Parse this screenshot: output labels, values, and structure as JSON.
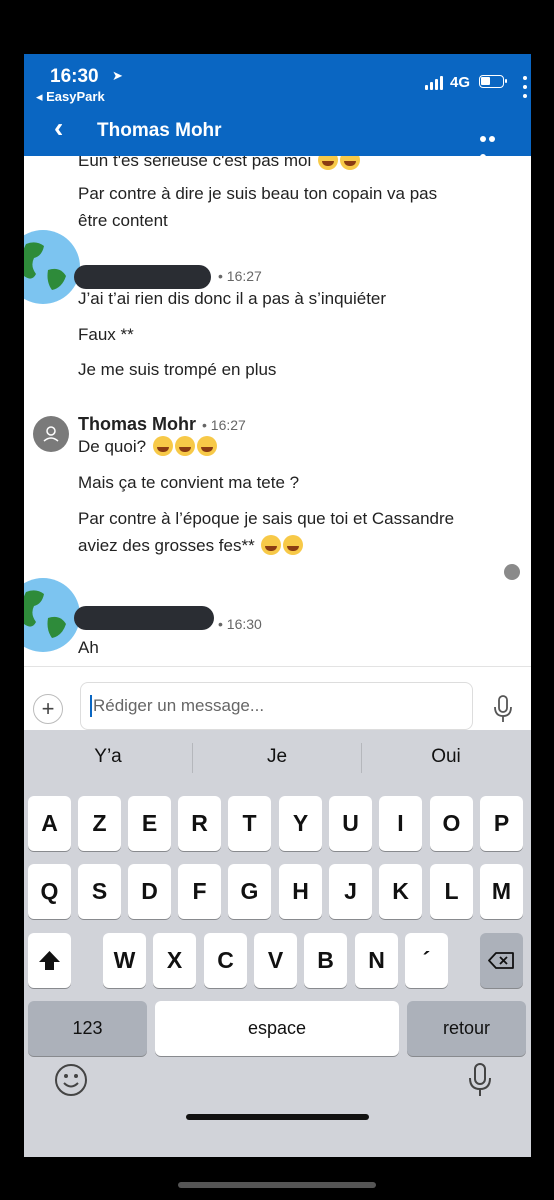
{
  "status_bar": {
    "time": "16:30",
    "back_app": "◂ EasyPark",
    "network": "4G"
  },
  "header": {
    "title": "Thomas Mohr"
  },
  "messages": [
    {
      "text": "Eun t'es sérieuse c'est pas moi",
      "emoji_count": 2
    },
    {
      "text": "Par contre à dire je suis beau ton copain va pas"
    },
    {
      "text": "être content"
    },
    {
      "sender_redacted": true,
      "meta": "• 16:27"
    },
    {
      "text": "J’ai t’ai rien dis donc il a pas à s’inquiéter"
    },
    {
      "text": "Faux **"
    },
    {
      "text": "Je me suis trompé en plus"
    },
    {
      "sender": "Thomas Mohr",
      "meta": "• 16:27"
    },
    {
      "text": "De quoi?",
      "emoji_count": 3
    },
    {
      "text": "Mais ça te convient ma tete ?"
    },
    {
      "text": "Par contre à l’époque je sais que toi et Cassandre"
    },
    {
      "text": "aviez des grosses fes**",
      "emoji_count": 2
    },
    {
      "sender_redacted": true,
      "meta": "• 16:30"
    },
    {
      "text": "Ah"
    }
  ],
  "composer": {
    "placeholder": "Rédiger un message..."
  },
  "keyboard": {
    "suggestions": [
      "Y’a",
      "Je",
      "Oui"
    ],
    "row1": [
      "A",
      "Z",
      "E",
      "R",
      "T",
      "Y",
      "U",
      "I",
      "O",
      "P"
    ],
    "row2": [
      "Q",
      "S",
      "D",
      "F",
      "G",
      "H",
      "J",
      "K",
      "L",
      "M"
    ],
    "row3": [
      "W",
      "X",
      "C",
      "V",
      "B",
      "N",
      "´"
    ],
    "numbers_key": "123",
    "space_key": "espace",
    "return_key": "retour"
  }
}
